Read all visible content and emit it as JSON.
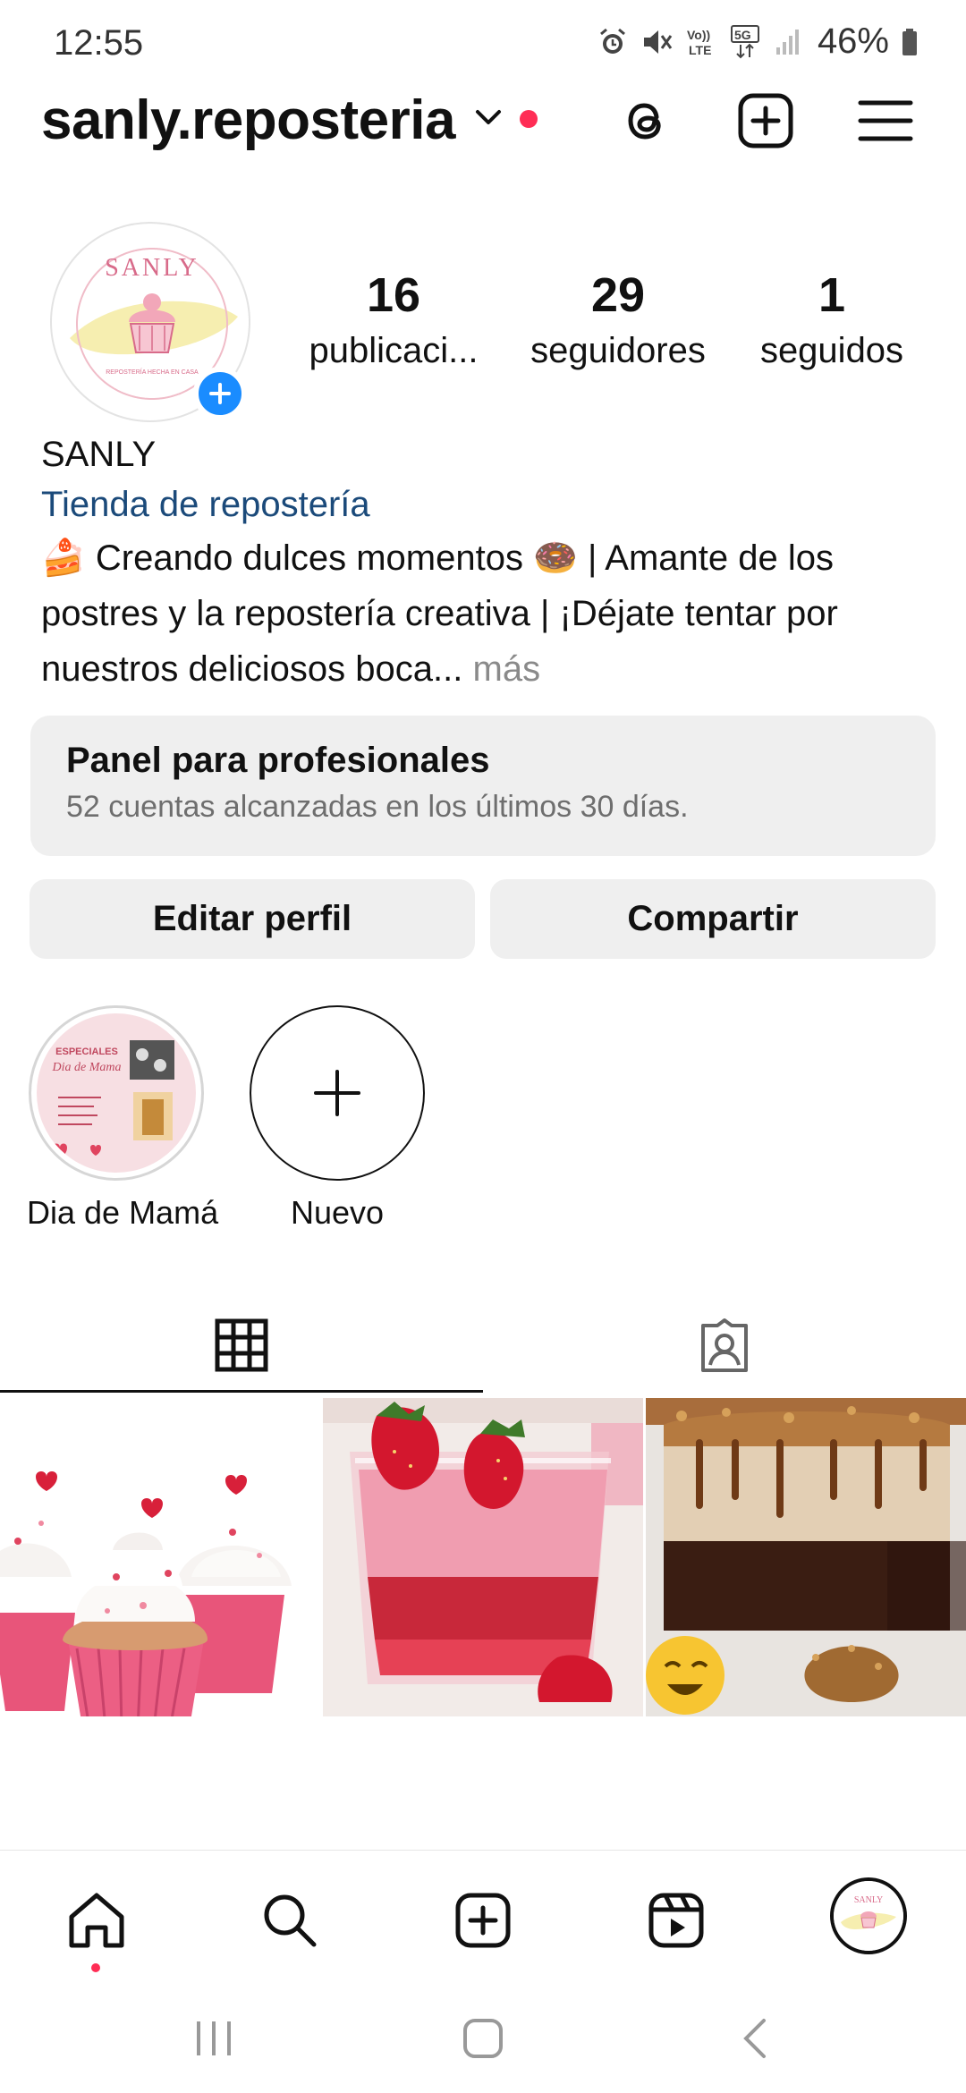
{
  "status_bar": {
    "time": "12:55",
    "battery": "46%",
    "icons": [
      "alarm-icon",
      "mute-icon",
      "volte-icon",
      "5g-icon",
      "signal-icon",
      "battery-icon"
    ]
  },
  "header": {
    "username": "sanly.reposteria",
    "icons": [
      "chevron-down-icon",
      "threads-icon",
      "create-post-icon",
      "menu-icon"
    ]
  },
  "profile": {
    "avatar_logo_text": "SANLY",
    "avatar_logo_tagline": "REPOSTERÍA HECHA EN CASA",
    "stats": [
      {
        "value": "16",
        "label": "publicaci..."
      },
      {
        "value": "29",
        "label": "seguidores"
      },
      {
        "value": "1",
        "label": "seguidos"
      }
    ],
    "display_name": "SANLY",
    "category": "Tienda de repostería",
    "bio_line_1": "🍰 Creando dulces momentos 🍩 | Amante de los",
    "bio_line_2": "postres y la repostería creativa | ¡Déjate tentar por",
    "bio_line_3": "nuestros deliciosos boca...",
    "bio_more": "más"
  },
  "professional_panel": {
    "title": "Panel para profesionales",
    "subtitle": "52 cuentas alcanzadas en los últimos 30 días."
  },
  "buttons": {
    "edit": "Editar perfil",
    "share": "Compartir"
  },
  "highlights": [
    {
      "label": "Dia de Mamá",
      "cover_title": "ESPECIALES",
      "cover_subtitle": "Dia de Mama"
    },
    {
      "label": "Nuevo"
    }
  ],
  "tabs": [
    "grid-icon",
    "tagged-icon"
  ],
  "posts": [
    "cupcakes-photo",
    "strawberry-mousse-photo",
    "chocolate-cake-photo"
  ],
  "bottom_nav": [
    "home-icon",
    "search-icon",
    "create-icon",
    "reels-icon",
    "profile-avatar"
  ],
  "system_nav": [
    "recents-icon",
    "home-button-icon",
    "back-icon"
  ],
  "colors": {
    "accent_blue": "#1a8cff",
    "notification_red": "#ff2d55",
    "category_link": "#1b4a7a",
    "panel_bg": "#efefef"
  }
}
